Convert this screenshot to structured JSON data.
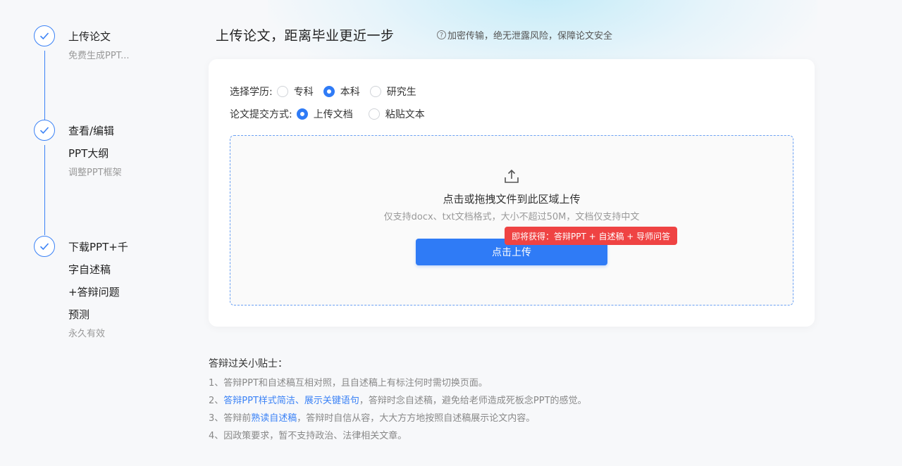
{
  "steps": [
    {
      "title_lines": [
        "上传论文"
      ],
      "subtitle": "免费生成PPT..."
    },
    {
      "title_lines": [
        "查看/编辑",
        "PPT大纲"
      ],
      "subtitle": "调整PPT框架"
    },
    {
      "title_lines": [
        "下载PPT+千",
        "字自述稿",
        "+答辩问题",
        "预测"
      ],
      "subtitle": "永久有效"
    }
  ],
  "header": {
    "title": "上传论文，距离毕业更近一步",
    "secure_icon": "?",
    "secure_note": "加密传输，绝无泄露风险，保障论文安全"
  },
  "form": {
    "education": {
      "label": "选择学历:",
      "options": [
        "专科",
        "本科",
        "研究生"
      ],
      "selected": "本科"
    },
    "submit_method": {
      "label": "论文提交方式:",
      "options": [
        "上传文档",
        "粘贴文本"
      ],
      "selected": "上传文档"
    }
  },
  "upload": {
    "icon": "upload-icon",
    "title": "点击或拖拽文件到此区域上传",
    "subtitle": "仅支持docx、txt文档格式，大小不超过50M，文档仅支持中文",
    "button_label": "点击上传",
    "badge": "即将获得：答辩PPT + 自述稿 + 导师问答"
  },
  "tips": {
    "title": "答辩过关小贴士：",
    "t1": "1、答辩PPT和自述稿互相对照，且自述稿上有标注何时需切换页面。",
    "t2_pre": "2、",
    "t2_hl": "答辩PPT样式简洁、展示关键语句",
    "t2_post": "，答辩时念自述稿，避免给老师造成死板念PPT的感觉。",
    "t3_pre": "3、答辩前",
    "t3_hl": "熟读自述稿",
    "t3_post": "，答辩时自信从容，大大方方地按照自述稿展示论文内容。",
    "t4": "4、因政策要求，暂不支持政治、法律相关文章。"
  },
  "colors": {
    "accent": "#2f7bf6",
    "badge": "#ef4343",
    "step_line": "#3b82f6"
  }
}
